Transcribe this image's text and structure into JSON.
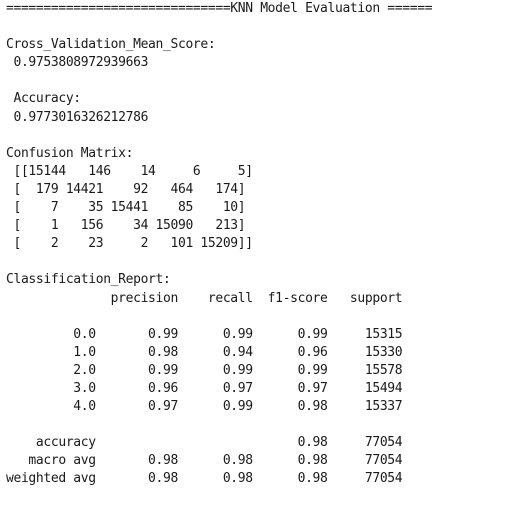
{
  "output": {
    "header": "==============================KNN Model Evaluation ======",
    "cv_label": "Cross_Validation_Mean_Score:",
    "cv_value": " 0.9753808972939663",
    "accuracy_label": " Accuracy:",
    "accuracy_value": " 0.9773016326212786",
    "confusion_label": "Confusion Matrix:",
    "confusion_rows": [
      " [[15144   146    14     6     5]",
      " [  179 14421    92   464   174]",
      " [    7    35 15441    85    10]",
      " [    1   156    34 15090   213]",
      " [    2    23     2   101 15209]]"
    ],
    "report_label": "Classification_Report:",
    "report_header": "              precision    recall  f1-score   support",
    "report_rows": [
      "         0.0       0.99      0.99      0.99     15315",
      "         1.0       0.98      0.94      0.96     15330",
      "         2.0       0.99      0.99      0.99     15578",
      "         3.0       0.96      0.97      0.97     15494",
      "         4.0       0.97      0.99      0.98     15337"
    ],
    "summary_rows": [
      "    accuracy                           0.98     77054",
      "   macro avg       0.98      0.98      0.98     77054",
      "weighted avg       0.98      0.98      0.98     77054"
    ]
  }
}
